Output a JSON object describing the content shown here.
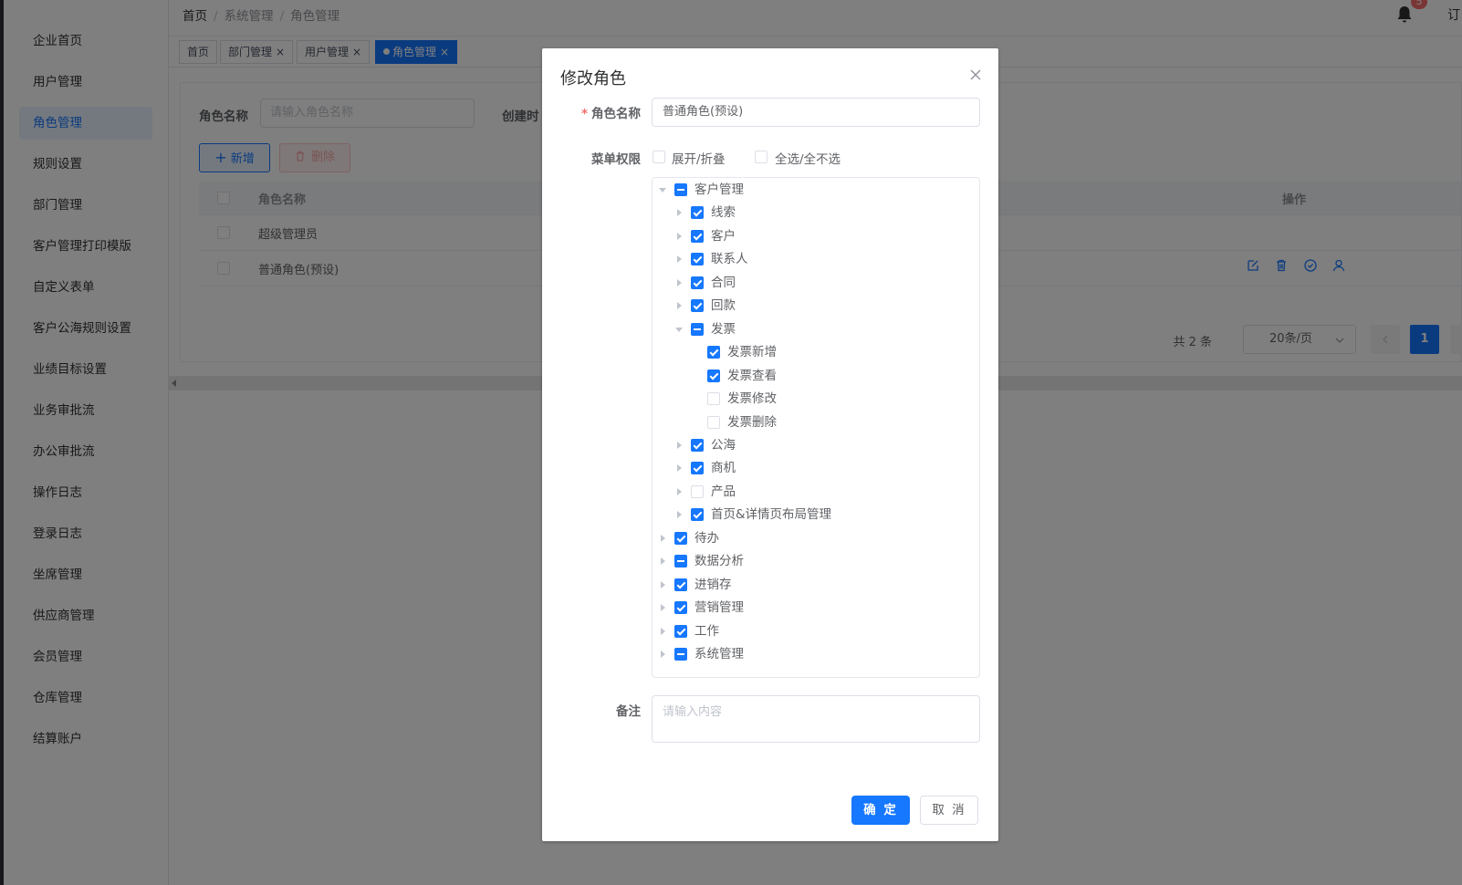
{
  "sidebar": {
    "items": [
      {
        "label": "企业首页"
      },
      {
        "label": "用户管理"
      },
      {
        "label": "角色管理",
        "active": true
      },
      {
        "label": "规则设置"
      },
      {
        "label": "部门管理"
      },
      {
        "label": "客户管理打印模版"
      },
      {
        "label": "自定义表单"
      },
      {
        "label": "客户公海规则设置"
      },
      {
        "label": "业绩目标设置"
      },
      {
        "label": "业务审批流"
      },
      {
        "label": "办公审批流"
      },
      {
        "label": "操作日志"
      },
      {
        "label": "登录日志"
      },
      {
        "label": "坐席管理"
      },
      {
        "label": "供应商管理"
      },
      {
        "label": "会员管理"
      },
      {
        "label": "仓库管理"
      },
      {
        "label": "结算账户"
      }
    ]
  },
  "header": {
    "breadcrumb": [
      "首页",
      "系统管理",
      "角色管理"
    ],
    "notification_count": "5",
    "right_text": "订"
  },
  "tags": [
    {
      "label": "首页",
      "closable": false
    },
    {
      "label": "部门管理",
      "closable": true
    },
    {
      "label": "用户管理",
      "closable": true
    },
    {
      "label": "角色管理",
      "closable": true,
      "active": true
    }
  ],
  "filter": {
    "role_name_label": "角色名称",
    "role_name_placeholder": "请输入角色名称",
    "created_label": "创建时"
  },
  "toolbar": {
    "add_label": "新增",
    "delete_label": "删除"
  },
  "table": {
    "columns": [
      "角色名称",
      "操作"
    ],
    "rows": [
      {
        "name": "超级管理员"
      },
      {
        "name": "普通角色(预设)"
      }
    ]
  },
  "pagination": {
    "total_text": "共 2 条",
    "page_size": "20条/页",
    "current_page": "1"
  },
  "dialog": {
    "title": "修改角色",
    "role_name_label": "角色名称",
    "role_name_value": "普通角色(预设)",
    "menu_label": "菜单权限",
    "expand_label": "展开/折叠",
    "select_all_label": "全选/全不选",
    "remark_label": "备注",
    "remark_placeholder": "请输入内容",
    "confirm_label": "确 定",
    "cancel_label": "取 消",
    "tree": [
      {
        "label": "客户管理",
        "level": 0,
        "state": "indeterminate",
        "arrow": "down"
      },
      {
        "label": "线索",
        "level": 1,
        "state": "checked",
        "arrow": "right"
      },
      {
        "label": "客户",
        "level": 1,
        "state": "checked",
        "arrow": "right"
      },
      {
        "label": "联系人",
        "level": 1,
        "state": "checked",
        "arrow": "right"
      },
      {
        "label": "合同",
        "level": 1,
        "state": "checked",
        "arrow": "right"
      },
      {
        "label": "回款",
        "level": 1,
        "state": "checked",
        "arrow": "right"
      },
      {
        "label": "发票",
        "level": 1,
        "state": "indeterminate",
        "arrow": "down"
      },
      {
        "label": "发票新增",
        "level": 2,
        "state": "checked",
        "arrow": "none"
      },
      {
        "label": "发票查看",
        "level": 2,
        "state": "checked",
        "arrow": "none"
      },
      {
        "label": "发票修改",
        "level": 2,
        "state": "unchecked",
        "arrow": "none"
      },
      {
        "label": "发票删除",
        "level": 2,
        "state": "unchecked",
        "arrow": "none"
      },
      {
        "label": "公海",
        "level": 1,
        "state": "checked",
        "arrow": "right"
      },
      {
        "label": "商机",
        "level": 1,
        "state": "checked",
        "arrow": "right"
      },
      {
        "label": "产品",
        "level": 1,
        "state": "unchecked",
        "arrow": "right"
      },
      {
        "label": "首页&详情页布局管理",
        "level": 1,
        "state": "checked",
        "arrow": "right"
      },
      {
        "label": "待办",
        "level": 0,
        "state": "checked",
        "arrow": "right"
      },
      {
        "label": "数据分析",
        "level": 0,
        "state": "indeterminate",
        "arrow": "right"
      },
      {
        "label": "进销存",
        "level": 0,
        "state": "checked",
        "arrow": "right"
      },
      {
        "label": "营销管理",
        "level": 0,
        "state": "checked",
        "arrow": "right"
      },
      {
        "label": "工作",
        "level": 0,
        "state": "checked",
        "arrow": "right"
      },
      {
        "label": "系统管理",
        "level": 0,
        "state": "indeterminate",
        "arrow": "right"
      }
    ]
  },
  "colors": {
    "primary": "#1677ff",
    "danger": "#f56c6c",
    "mask": "rgba(0,0,0,0.5)"
  },
  "icons": [
    "bell-icon",
    "plus-icon",
    "trash-icon",
    "close-icon",
    "edit-icon",
    "check-circle-icon",
    "user-icon",
    "chevron-left-icon",
    "chevron-right-icon",
    "chevron-down-icon"
  ]
}
